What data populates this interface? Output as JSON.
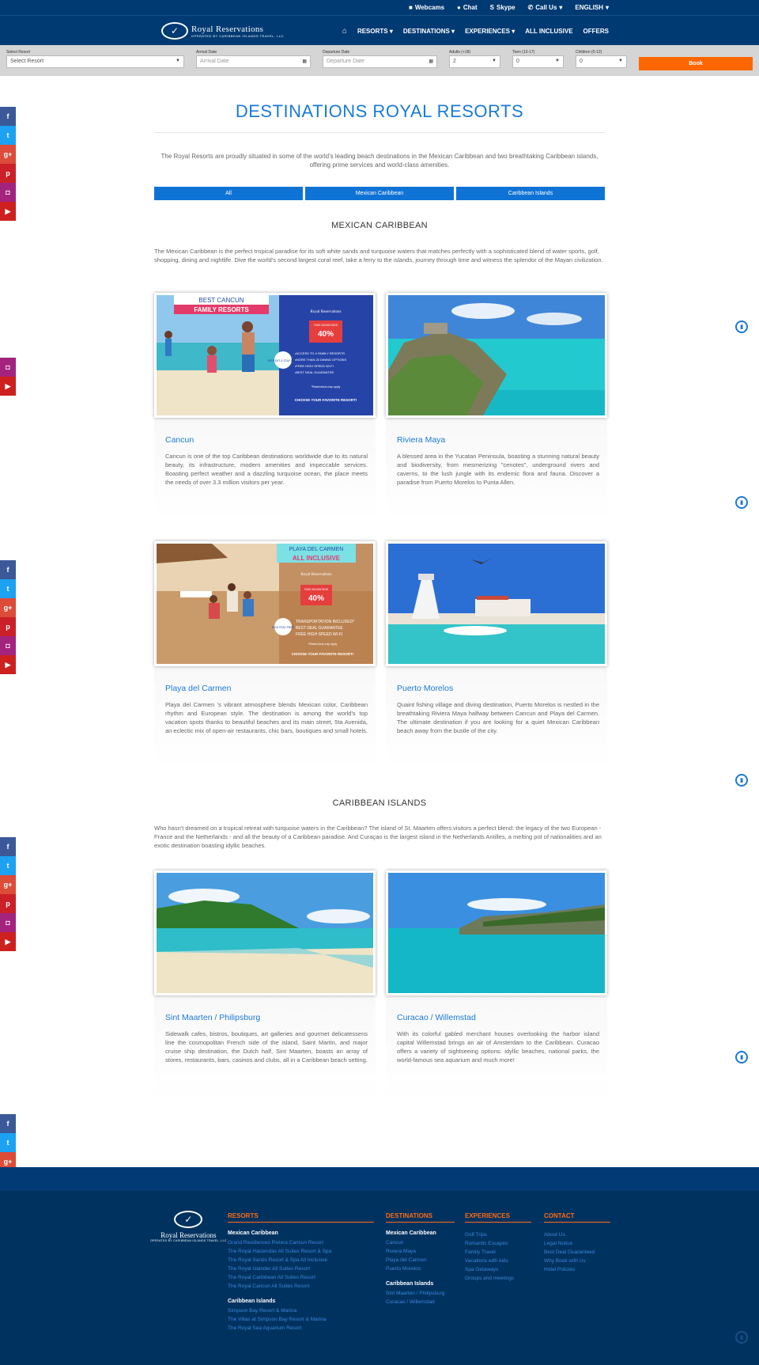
{
  "topbar": {
    "webcams": "Webcams",
    "chat": "Chat",
    "skype": "Skype",
    "callus": "Call Us",
    "language": "ENGLISH"
  },
  "logo": {
    "name": "Royal Reservations",
    "tagline": "OPERATED BY CARIBBEAN ISLANDS TRAVEL, LLC"
  },
  "nav": {
    "items": [
      "RESORTS",
      "DESTINATIONS",
      "EXPERIENCES",
      "ALL INCLUSIVE",
      "OFFERS"
    ]
  },
  "search": {
    "resort_label": "Select Resort",
    "resort_value": "Select Resort",
    "arrival_label": "Arrival Date",
    "arrival_placeholder": "Arrival Date",
    "departure_label": "Departure Date",
    "departure_placeholder": "Departure Date",
    "adults_label": "Adults (+18)",
    "adults_value": "2",
    "teens_label": "Teen (13-17)",
    "teens_value": "0",
    "children_label": "Children (0-12)",
    "children_value": "0",
    "book_label": "Book"
  },
  "page": {
    "title": "DESTINATIONS ROYAL RESORTS",
    "intro": "The Royal Resorts are proudly situated in some of the world's leading beach destinations in the Mexican Caribbean and two breathtaking Caribbean islands, offering prime services and world-class amenities."
  },
  "tabs": [
    "All",
    "Mexican Caribbean",
    "Caribbean Islands"
  ],
  "mexican": {
    "heading": "MEXICAN CARIBBEAN",
    "text": "The Mexican Caribbean is the perfect tropical paradise for its soft white sands and turquoise waters that matches perfectly with a sophisticated blend of water sports, golf, shopping, dining and nightlife. Dive the world's second largest coral reef, take a ferry to the islands, journey through time and witness the splendor of the Mayan civilization."
  },
  "islands": {
    "heading": "CARIBBEAN ISLANDS",
    "text": "Who hasn't dreamed on a tropical retreat with turquoise waters in the Caribbean? The island of St. Maarten offers visitors a perfect blend: the legacy of the two European - France and the Netherlands - and all the beauty of a Caribbean paradise. And Curaçao is the largest island in the Netherlands Antilles, a melting pot of nationalities and an exotic destination boasting idyllic beaches."
  },
  "cards": [
    {
      "title": "Cancun",
      "text": "Cancun is one of the top Caribbean destinations worldwide due to its natural beauty, its infrastructure, modern amenities and impeccable services. Boasting perfect weather and a dazzling turquoise ocean, the place meets the needs of over 3.3 million visitors per year."
    },
    {
      "title": "Riviera Maya",
      "text": "A blessed area in the Yucatan Peninsula, boasting a stunning natural beauty and biodiversity, from mesmerizing \"cenotes\", underground rivers and caverns, to the lush jungle with its endemic flora and fauna. Discover a paradise from Puerto Morelos to Punta Allen."
    },
    {
      "title": "Playa del Carmen",
      "text": "Playa del Carmen 's vibrant atmosphere blends Mexican color, Caribbean rhythm and European style. The destination is among the world's top vacation spots thanks to beautiful beaches and its main street, 5ta Avenida, an eclectic mix of open-air restaurants, chic bars, boutiques and small hotels."
    },
    {
      "title": "Puerto Morelos",
      "text": "Quaint fishing village and diving destination, Puerto Morelos is nestled in the breathtaking Riviera Maya halfway between Cancun and Playa del Carmen. The ultimate destination if you are looking for a quiet Mexican Caribbean beach away from the bustle of the city."
    },
    {
      "title": "Sint Maarten / Philipsburg",
      "text": "Sidewalk cafes, bistros, boutiques, art galleries and gourmet delicatessens line the cosmopolitan French side of the island, Saint Martin, and major cruise ship destination, the Dutch half, Sint Maarten, boasts an array of stores, restaurants, bars, casinos and clubs, all in a Caribbean beach setting."
    },
    {
      "title": "Curacao / Willemstad",
      "text": "With its colorful gabled merchant houses overlooking the harbor island capital Willemstad brings an air of Amsterdam to the Caribbean. Curacao offers a variety of sightseeing options: idyllic beaches, national parks, the world-famous sea aquarium and much more!"
    }
  ],
  "promo1": {
    "banner": "BEST CANCUN",
    "banner2": "FAMILY RESORTS",
    "take": "TAKE ADVANTAGE",
    "upto": "UP TO",
    "discount": "40%",
    "off": "OFF",
    "kids": "KIDS EAT & STAY FREE",
    "b1": "•ACCESS TO 4 FAMILY RESORTS",
    "b2": "•MORE THAN 20 DINING OPTIONS",
    "b3": "•FREE HIGH SPEED WI-FI",
    "b4": "•BEST DEAL GUARANTEE",
    "restr": "*Restrictions may apply",
    "cta": "CHOOSE YOUR FAVORITE RESORT!"
  },
  "promo2": {
    "banner": "PLAYA DEL CARMEN",
    "banner2": "ALL INCLUSIVE",
    "take": "TAKE ADVANTAGE",
    "discount": "40%",
    "off": "OFF",
    "kids": "KIDS STAY FREE",
    "b1": "TRANSPORTATION INCLUDED*",
    "b2": "BEST DEAL GUARANTEE",
    "b3": "FREE HIGH SPEED WI-FI",
    "restr": "*Restrictions may apply",
    "cta": "CHOOSE YOUR FAVORITE RESORT!"
  },
  "footer": {
    "resorts_heading": "RESORTS",
    "resorts_mx_sub": "Mexican Caribbean",
    "resorts_mx": [
      "Grand Residences Riviera Cancun Resort",
      "The Royal Haciendas All Suites Resort & Spa",
      "The Royal Sands Resort & Spa All Inclusive",
      "The Royal Islander All Suites Resort",
      "The Royal Caribbean All Suites Resort",
      "The Royal Cancun All Suites Resort"
    ],
    "resorts_ci_sub": "Caribbean Islands",
    "resorts_ci": [
      "Simpson Bay Resort & Marina",
      "The Villas at Simpson Bay Resort & Marina",
      "The Royal Sea Aquarium Resort"
    ],
    "dest_heading": "DESTINATIONS",
    "dest_mx_sub": "Mexican Caribbean",
    "dest_mx": [
      "Cancun",
      "Riviera Maya",
      "Playa del Carmen",
      "Puerto Morelos"
    ],
    "dest_ci_sub": "Caribbean Islands",
    "dest_ci": [
      "Sint Maarten / Philipsburg",
      "Curacao / Willemstad"
    ],
    "exp_heading": "EXPERIENCES",
    "exp": [
      "Golf Trips",
      "Romantic Escapes",
      "Family Travel",
      "Vacations with kids",
      "Spa Getaways",
      "Groups and meetings"
    ],
    "contact_heading": "CONTACT",
    "contact": [
      "About Us",
      "Legal Notice",
      "Best Deal Guaranteed",
      "Why Book with Us",
      "Hotel Policies"
    ]
  },
  "colors": {
    "navy": "#003a73",
    "accent_blue": "#1a7ad6",
    "book_orange": "#ff6600",
    "footer_orange": "#ff6a13"
  }
}
